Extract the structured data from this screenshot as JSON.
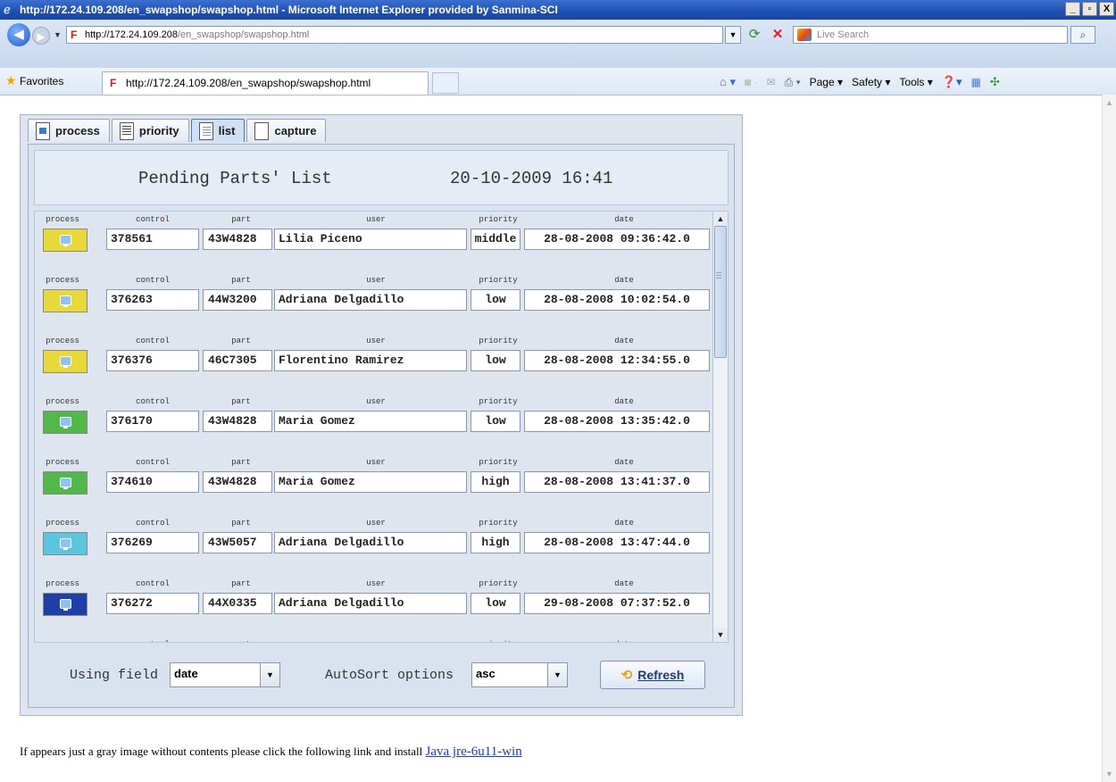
{
  "window": {
    "title": "http://172.24.109.208/en_swapshop/swapshop.html - Microsoft Internet Explorer provided by Sanmina-SCI",
    "minimize": "_",
    "maximize": "▫",
    "close": "X"
  },
  "address": {
    "url_host": "http://172.24.109.208",
    "url_path": "/en_swapshop/swapshop.html",
    "search_placeholder": "Live Search"
  },
  "favorites": {
    "label": "Favorites",
    "tab_title": "http://172.24.109.208/en_swapshop/swapshop.html"
  },
  "command_bar": {
    "page": "Page ▾",
    "safety": "Safety ▾",
    "tools": "Tools ▾"
  },
  "applet": {
    "tabs": [
      {
        "label": "process",
        "icon": "process-icon"
      },
      {
        "label": "priority",
        "icon": "priority-icon"
      },
      {
        "label": "list",
        "icon": "list-icon",
        "active": true
      },
      {
        "label": "capture",
        "icon": "capture-icon"
      }
    ],
    "header": {
      "title": "Pending Parts' List",
      "datetime": "20-10-2009 16:41"
    },
    "columns": {
      "process": "process",
      "control": "control",
      "part": "part",
      "user": "user",
      "priority": "priority",
      "date": "date"
    },
    "rows": [
      {
        "process_color": "#e8d93a",
        "control": "378561",
        "part": "43W4828",
        "user": "Lilia Piceno",
        "priority": "middle",
        "date": "28-08-2008 09:36:42.0"
      },
      {
        "process_color": "#e8d93a",
        "control": "376263",
        "part": "44W3200",
        "user": "Adriana Delgadillo",
        "priority": "low",
        "date": "28-08-2008 10:02:54.0"
      },
      {
        "process_color": "#e8d93a",
        "control": "376376",
        "part": "46C7305",
        "user": "Florentino Ramirez",
        "priority": "low",
        "date": "28-08-2008 12:34:55.0"
      },
      {
        "process_color": "#52b84a",
        "control": "376170",
        "part": "43W4828",
        "user": "Maria Gomez",
        "priority": "low",
        "date": "28-08-2008 13:35:42.0"
      },
      {
        "process_color": "#52b84a",
        "control": "374610",
        "part": "43W4828",
        "user": "Maria Gomez",
        "priority": "high",
        "date": "28-08-2008 13:41:37.0"
      },
      {
        "process_color": "#5cc6de",
        "control": "376269",
        "part": "43W5057",
        "user": "Adriana Delgadillo",
        "priority": "high",
        "date": "28-08-2008 13:47:44.0"
      },
      {
        "process_color": "#1e3fa8",
        "control": "376272",
        "part": "44X0335",
        "user": "Adriana Delgadillo",
        "priority": "low",
        "date": "29-08-2008 07:37:52.0"
      }
    ],
    "controls": {
      "using_field_label": "Using field",
      "using_field_value": "date",
      "autosort_label": "AutoSort options",
      "autosort_value": "asc",
      "refresh_label": "Refresh"
    }
  },
  "footer": {
    "text": "If appears just a gray image without contents please click the following link and install ",
    "link": "Java jre-6u11-win"
  }
}
